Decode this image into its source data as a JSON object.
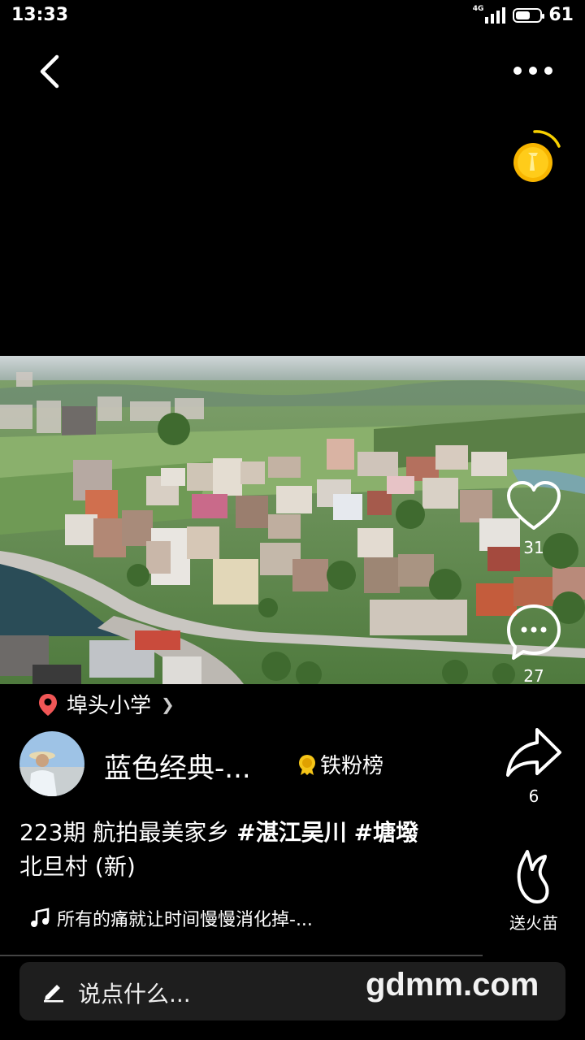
{
  "status_bar": {
    "time": "13:33",
    "network": "4G",
    "battery": "61",
    "battery_level": 0.61
  },
  "location": {
    "name": "埠头小学"
  },
  "actions": {
    "like_count": "31",
    "comment_count": "27",
    "share_count": "6",
    "fire_label": "送火苗"
  },
  "author": {
    "name": "蓝色经典-...",
    "badge": "铁粉榜"
  },
  "description": {
    "prefix": "223期 航拍最美家乡 ",
    "tag1": "#湛江吴川",
    "tag2": "#塘墢",
    "rest": "北旦村 (新)"
  },
  "music": {
    "title": "所有的痛就让时间慢慢消化掉-..."
  },
  "input": {
    "placeholder": "说点什么..."
  },
  "watermark": "gdmm.com",
  "colors": {
    "location_pin": "#f05656",
    "coin": "#f7b500",
    "badge": "#f5c518"
  }
}
